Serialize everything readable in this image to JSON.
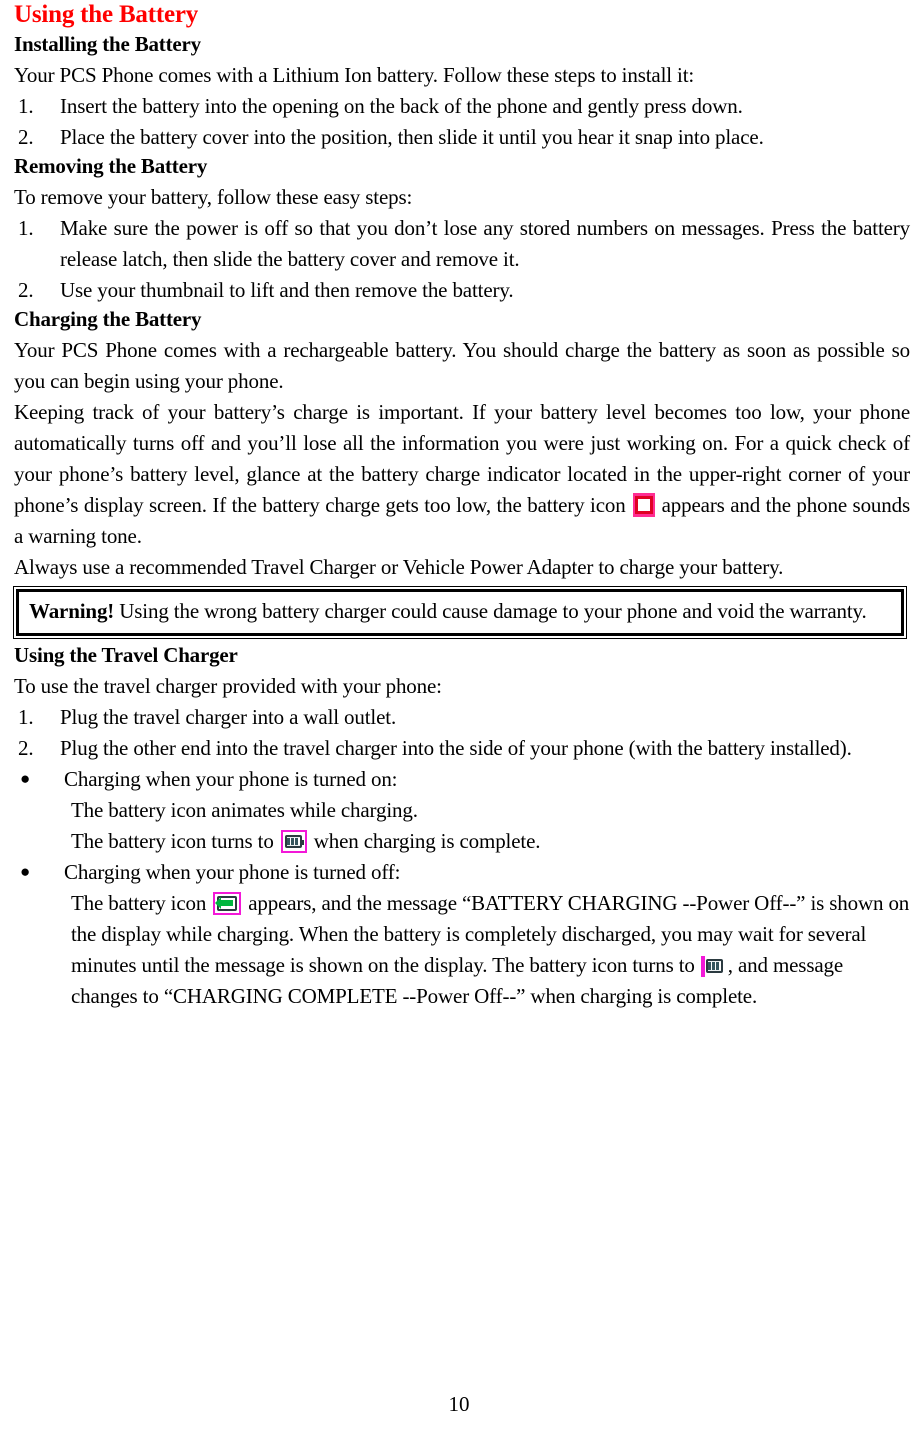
{
  "document": {
    "page_number": "10",
    "title": "Using the Battery",
    "title_color": "#ff0000"
  },
  "sections": {
    "installing": {
      "heading": "Installing the Battery",
      "intro": "Your PCS Phone comes with a Lithium Ion battery. Follow these steps to install it:",
      "steps": [
        {
          "num": "1.",
          "text": "Insert the battery into the opening on the back of the phone and gently press down."
        },
        {
          "num": "2.",
          "text": "Place the battery cover into the position, then slide it until you hear it snap into place."
        }
      ]
    },
    "removing": {
      "heading": "Removing the Battery",
      "intro": "To remove your battery, follow these easy steps:",
      "steps": [
        {
          "num": "1.",
          "text": "Make sure the power is off so that you don’t lose any stored numbers on messages. Press the battery release latch, then slide the battery cover and remove it."
        },
        {
          "num": "2.",
          "text": "Use your thumbnail to lift and then remove the battery."
        }
      ]
    },
    "charging": {
      "heading": "Charging the Battery",
      "para1": "Your PCS Phone comes with a rechargeable battery. You should charge the battery as soon as possible so you can begin using your phone.",
      "para2_before_icon": "Keeping track of your battery’s charge is important. If your battery level becomes too low, your phone automatically turns off and you’ll lose all the information you were just working on. For a quick check of your phone’s battery level, glance at the battery charge indicator located in the upper-right corner of your phone’s display screen. If the battery charge gets too low, the battery icon",
      "para2_after_icon": "appears and the phone sounds a warning tone.",
      "para3": "Always use a recommended Travel Charger or Vehicle Power Adapter to charge your battery."
    },
    "warning": {
      "label": "Warning!",
      "text": "Using the wrong battery charger could cause damage to your phone and void the warranty."
    },
    "travel_charger": {
      "heading": "Using the Travel Charger",
      "intro": "To use the travel charger provided with your phone:",
      "steps": [
        {
          "num": "1.",
          "text": "Plug the travel charger into a wall outlet."
        },
        {
          "num": "2.",
          "text": "Plug the other end into the travel charger into the side of your phone (with the battery installed)."
        }
      ],
      "bullets": [
        {
          "marker": "●",
          "text": "Charging when your phone is turned on:"
        },
        {
          "marker": "●",
          "text": "Charging when your phone is turned off:"
        }
      ],
      "on_line1": "The battery icon animates while charging.",
      "on_line2_before_icon": "The battery icon turns to",
      "on_line2_after_icon": "when charging is complete.",
      "off_before_icon1": "The battery icon",
      "off_after_icon1": "appears, and the message “BATTERY CHARGING --Power Off--” is shown on the display while charging. When the battery is completely discharged, you may wait for several minutes until the message is shown on the display. The battery icon turns",
      "off_before_icon2": "to",
      "off_after_icon2": ", and message changes to “CHARGING COMPLETE --Power Off--” when charging is complete."
    }
  },
  "icons": {
    "battery_empty": "battery-empty-icon",
    "battery_full": "battery-full-icon",
    "battery_full_small": "battery-full-small-icon",
    "battery_charging": "battery-charging-icon"
  }
}
